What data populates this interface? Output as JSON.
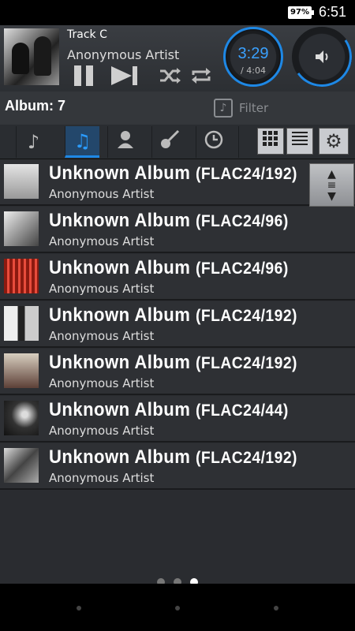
{
  "status": {
    "battery": "97%",
    "time": "6:51"
  },
  "player": {
    "track": "Track C",
    "artist": "Anonymous Artist",
    "elapsed": "3:29",
    "total": "/ 4:04",
    "progress": 0.86,
    "volume": 0.45
  },
  "library": {
    "album_count": "Album: 7",
    "filter_placeholder": "Filter"
  },
  "tabs": [
    {
      "name": "songs",
      "icon": "♪"
    },
    {
      "name": "albums",
      "icon": "♫"
    },
    {
      "name": "artists",
      "icon": "●"
    },
    {
      "name": "genres",
      "icon": "🎸"
    },
    {
      "name": "recent",
      "icon": "◷"
    }
  ],
  "albums": [
    {
      "title": "Unknown Album",
      "format": "(FLAC24/192)",
      "artist": "Anonymous Artist",
      "thumb": "#c8c8c8"
    },
    {
      "title": "Unknown Album",
      "format": "(FLAC24/96)",
      "artist": "Anonymous Artist",
      "thumb": "#9a9a9a"
    },
    {
      "title": "Unknown Album",
      "format": "(FLAC24/96)",
      "artist": "Anonymous Artist",
      "thumb": "#c0392b"
    },
    {
      "title": "Unknown Album",
      "format": "(FLAC24/192)",
      "artist": "Anonymous Artist",
      "thumb": "#b6b0a6"
    },
    {
      "title": "Unknown Album",
      "format": "(FLAC24/192)",
      "artist": "Anonymous Artist",
      "thumb": "#8d6e63"
    },
    {
      "title": "Unknown Album",
      "format": "(FLAC24/44)",
      "artist": "Anonymous Artist",
      "thumb": "#555555"
    },
    {
      "title": "Unknown Album",
      "format": "(FLAC24/192)",
      "artist": "Anonymous Artist",
      "thumb": "#a0a0a0"
    }
  ],
  "pager": {
    "count": 3,
    "active": 2
  }
}
